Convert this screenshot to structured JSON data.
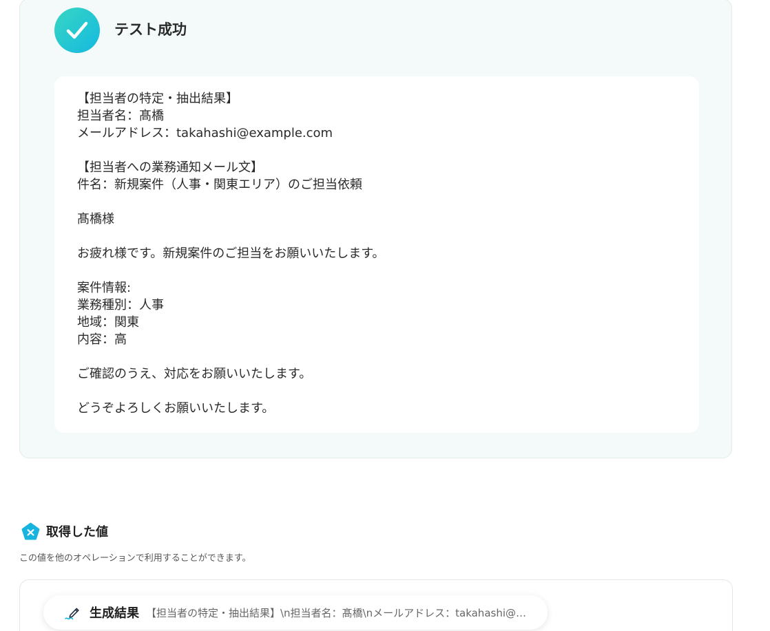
{
  "test_result": {
    "title": "テスト成功",
    "output_text": "【担当者の特定・抽出結果】\n担当者名：髙橋\nメールアドレス：takahashi@example.com\n\n【担当者への業務通知メール文】\n件名：新規案件（人事・関東エリア）のご担当依頼\n\n髙橋様\n\nお疲れ様です。新規案件のご担当をお願いいたします。\n\n案件情報:\n業務種別：人事\n地域：関東\n内容：高\n\nご確認のうえ、対応をお願いいたします。\n\nどうぞよろしくお願いいたします。"
  },
  "obtained_values": {
    "title": "取得した値",
    "description": "この値を他のオペレーションで利用することができます。",
    "items": [
      {
        "label": "生成結果",
        "value": "【担当者の特定・抽出結果】\\n担当者名：髙橋\\nメールアドレス：takahashi@example.com"
      }
    ]
  },
  "colors": {
    "accent_start": "#37d6c2",
    "accent_end": "#15b9e0",
    "panel_bg": "#f3faf9"
  },
  "icons": {
    "success": "check-icon",
    "section": "variable-pentagon-icon",
    "chip": "pencil-icon"
  }
}
